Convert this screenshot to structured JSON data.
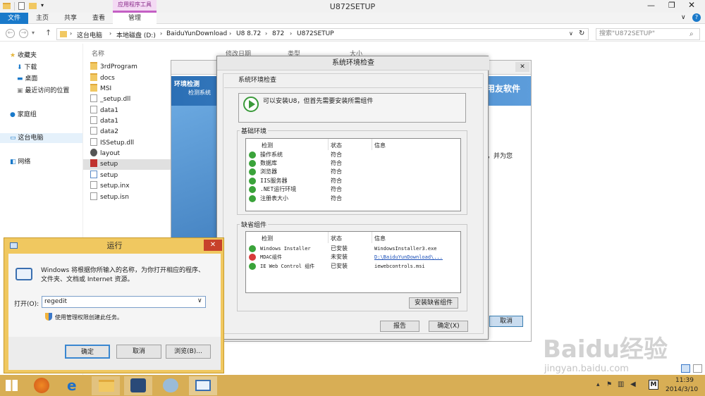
{
  "explorer": {
    "window_title": "U872SETUP",
    "context_tab_header": "应用程序工具",
    "ribbon_tabs": [
      "文件",
      "主页",
      "共享",
      "查看",
      "管理"
    ],
    "breadcrumb": [
      "这台电脑",
      "本地磁盘 (D:)",
      "BaiduYunDownload",
      "U8 8.72",
      "872",
      "U872SETUP"
    ],
    "search_placeholder": "搜索\"U872SETUP\"",
    "columns": [
      "名称",
      "修改日期",
      "类型",
      "大小"
    ],
    "nav": {
      "favorites": "收藏夹",
      "downloads": "下载",
      "desktop": "桌面",
      "recent": "最近访问的位置",
      "homegroup": "家庭组",
      "this_pc": "这台电脑",
      "network": "网络"
    },
    "files": [
      "3rdProgram",
      "docs",
      "MSI",
      "_setup.dll",
      "data1",
      "data1",
      "data2",
      "ISSetup.dll",
      "layout",
      "setup",
      "setup",
      "setup.inx",
      "setup.isn"
    ]
  },
  "installer_bg": {
    "tab_label": "环境检测",
    "sub_label": "检测系统",
    "brand": "用友软件",
    "side_text": "，并为您",
    "cancel": "取消"
  },
  "check_dialog": {
    "title": "系统环境检查",
    "section_title": "系统环境检查",
    "status_message": "可以安装U8，但首先需要安装所需组件",
    "basic_group": "基础环境",
    "basic_headers": [
      "检测",
      "状态",
      "信息"
    ],
    "basic_rows": [
      {
        "name": "操作系统",
        "status": "符合",
        "info": ""
      },
      {
        "name": "数据库",
        "status": "符合",
        "info": ""
      },
      {
        "name": "浏览器",
        "status": "符合",
        "info": ""
      },
      {
        "name": "IIS服务器",
        "status": "符合",
        "info": ""
      },
      {
        "name": ".NET运行环境",
        "status": "符合",
        "info": ""
      },
      {
        "name": "注册表大小",
        "status": "符合",
        "info": ""
      }
    ],
    "missing_group": "缺省组件",
    "missing_headers": [
      "检测",
      "状态",
      "信息"
    ],
    "missing_rows": [
      {
        "name": "Windows Installer",
        "status": "已安装",
        "info": "WindowsInstaller3.exe"
      },
      {
        "name": "MDAC组件",
        "status": "未安装",
        "info": "D:\\BaiduYunDownload\\..."
      },
      {
        "name": "IE Web Control 组件",
        "status": "已安装",
        "info": "iewebcontrols.msi"
      }
    ],
    "install_button": "安装缺省组件",
    "report_button": "报告",
    "ok_button": "确定(X)"
  },
  "run_dialog": {
    "title": "运行",
    "close": "✕",
    "description": "Windows 将根据你所输入的名称，为你打开相应的程序、文件夹、文档或 Internet 资源。",
    "open_label": "打开(O):",
    "open_value": "regedit",
    "admin_note": "使用管理权限创建此任务。",
    "ok": "确定",
    "cancel": "取消",
    "browse": "浏览(B)..."
  },
  "watermark": {
    "brand": "Baidu经验",
    "url": "jingyan.baidu.com"
  },
  "taskbar": {
    "time": "11:39",
    "date": "2014/3/10",
    "ime": "M"
  }
}
